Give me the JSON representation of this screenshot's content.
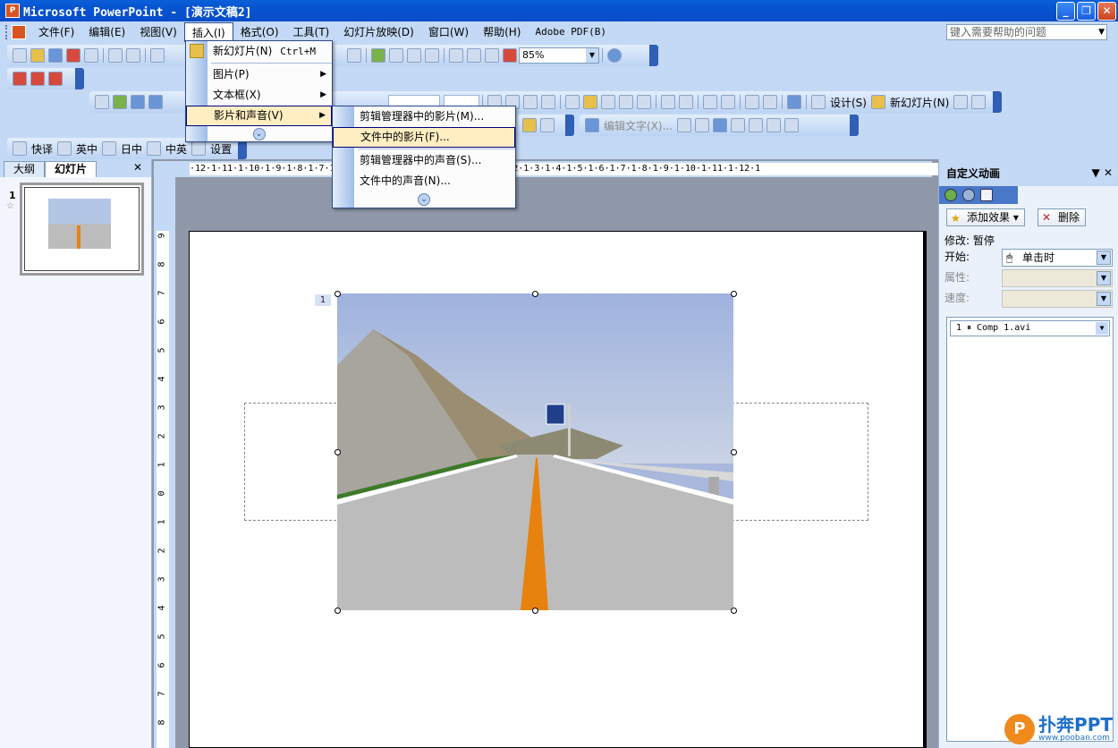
{
  "window": {
    "title": "Microsoft PowerPoint - [演示文稿2]",
    "minimize": "_",
    "restore": "❐",
    "close": "✕"
  },
  "menubar": {
    "items": [
      "文件(F)",
      "编辑(E)",
      "视图(V)",
      "插入(I)",
      "格式(O)",
      "工具(T)",
      "幻灯片放映(D)",
      "窗口(W)",
      "帮助(H)",
      "Adobe PDF(B)"
    ],
    "help_placeholder": "键入需要帮助的问题"
  },
  "toolbar": {
    "zoom": "85%",
    "design_label": "设计(S)",
    "new_slide_label": "新幻灯片(N)",
    "edit_text_label": "编辑文字(X)...",
    "ime": [
      "快译",
      "英中",
      "日中",
      "中英",
      "设置"
    ]
  },
  "left_panel": {
    "tabs": [
      "大纲",
      "幻灯片"
    ],
    "close": "✕",
    "slide_number": "1",
    "slide_star": "☆"
  },
  "ruler": {
    "horizontal_text": "·12·1·11·1·10·1·9·1·8·1·7·1·6·1·5·1·4·1·3·1·2·1·1·1·0·1·1·1·2·1·3·1·4·1·5·1·6·1·7·1·8·1·9·1·10·1·11·1·12·1",
    "vertical_labels": [
      "9",
      "8",
      "7",
      "6",
      "5",
      "4",
      "3",
      "2",
      "1",
      "0",
      "1",
      "2",
      "3",
      "4",
      "5",
      "6",
      "7",
      "8"
    ]
  },
  "slide": {
    "anim_marker": "1"
  },
  "insert_menu": {
    "items": [
      {
        "label": "新幻灯片(N)",
        "shortcut": "Ctrl+M",
        "submenu": false
      },
      {
        "label": "图片(P)",
        "shortcut": "",
        "submenu": true
      },
      {
        "label": "文本框(X)",
        "shortcut": "",
        "submenu": true
      },
      {
        "label": "影片和声音(V)",
        "shortcut": "",
        "submenu": true
      }
    ]
  },
  "media_submenu": {
    "items": [
      "剪辑管理器中的影片(M)...",
      "文件中的影片(F)...",
      "剪辑管理器中的声音(S)...",
      "文件中的声音(N)..."
    ]
  },
  "task_pane": {
    "title": "自定义动画",
    "add_effect": "添加效果",
    "remove": "删除",
    "modify_label": "修改: 暂停",
    "start_label": "开始:",
    "start_value": "单击时",
    "property_label": "属性:",
    "speed_label": "速度:",
    "list_item": "1  ⏸ Comp 1.avi"
  },
  "watermark": {
    "brand": "扑奔PPT",
    "url": "www.pooban.com"
  },
  "colors": {
    "title_bar": "#0a5fd8",
    "toolbar_bg": "#c4d9f5",
    "menu_highlight": "#ffeec2",
    "lane_orange": "#e8820e"
  }
}
